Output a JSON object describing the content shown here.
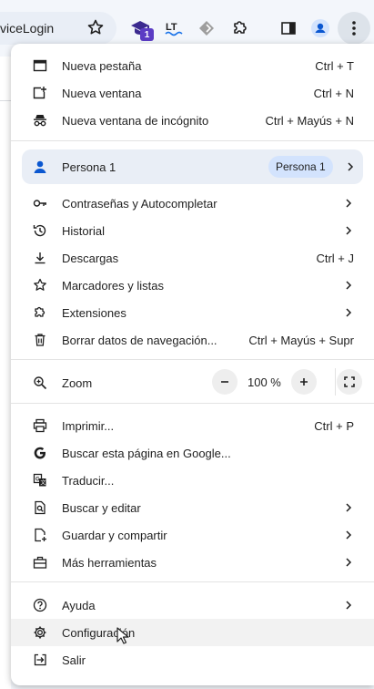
{
  "toolbar": {
    "omnibox_text": "viceLogin",
    "extension_badge": "1"
  },
  "menu": {
    "items_top": [
      {
        "label": "Nueva pestaña",
        "shortcut": "Ctrl + T"
      },
      {
        "label": "Nueva ventana",
        "shortcut": "Ctrl + N"
      },
      {
        "label": "Nueva ventana de incógnito",
        "shortcut": "Ctrl + Mayús + N"
      }
    ],
    "profile": {
      "label": "Persona 1",
      "pill": "Persona 1"
    },
    "items_mid": [
      {
        "label": "Contraseñas y Autocompletar"
      },
      {
        "label": "Historial"
      },
      {
        "label": "Descargas",
        "shortcut": "Ctrl + J"
      },
      {
        "label": "Marcadores y listas"
      },
      {
        "label": "Extensiones"
      },
      {
        "label": "Borrar datos de navegación...",
        "shortcut": "Ctrl + Mayús + Supr"
      }
    ],
    "zoom": {
      "label": "Zoom",
      "value": "100 %"
    },
    "items_tools": [
      {
        "label": "Imprimir...",
        "shortcut": "Ctrl + P"
      },
      {
        "label": "Buscar esta página en Google..."
      },
      {
        "label": "Traducir..."
      },
      {
        "label": "Buscar y editar"
      },
      {
        "label": "Guardar y compartir"
      },
      {
        "label": "Más herramientas"
      }
    ],
    "items_bottom": [
      {
        "label": "Ayuda"
      },
      {
        "label": "Configuración"
      },
      {
        "label": "Salir"
      }
    ]
  }
}
